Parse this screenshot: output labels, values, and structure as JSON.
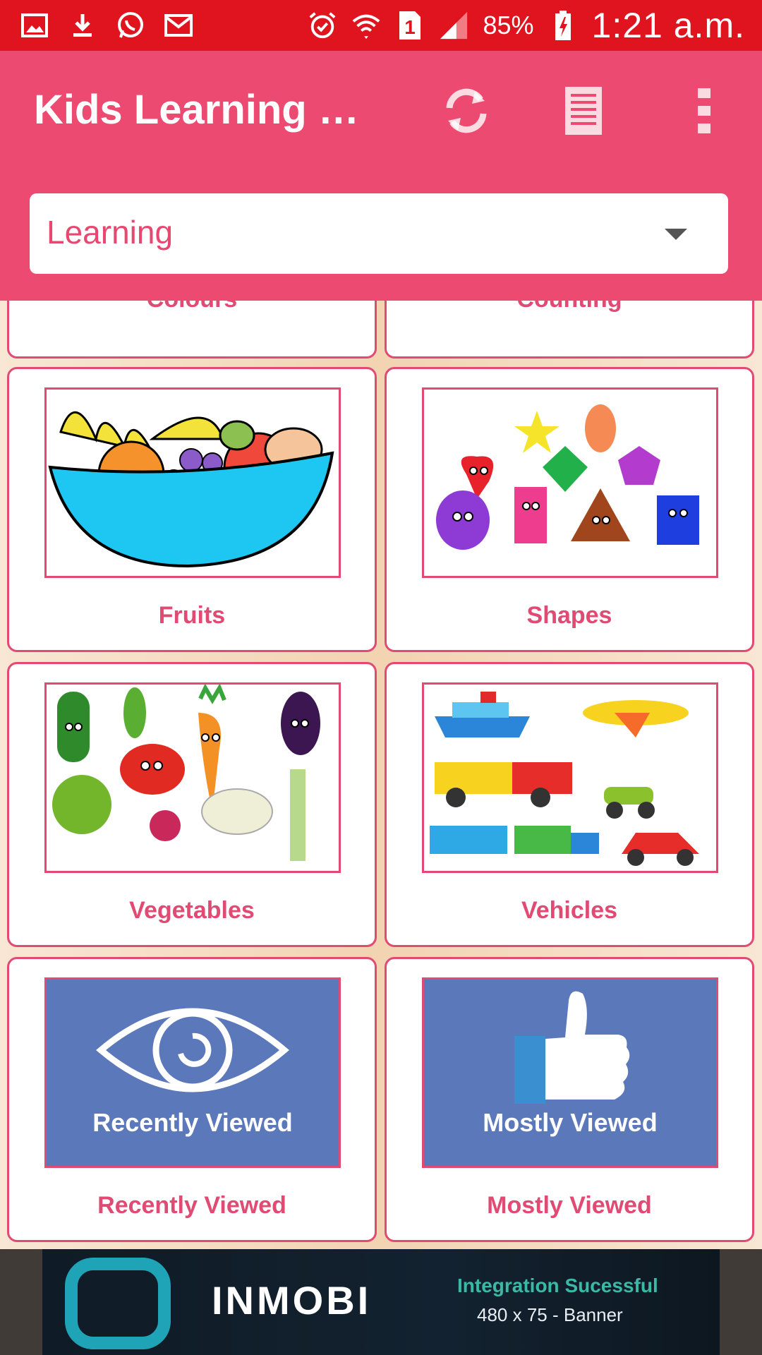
{
  "status_bar": {
    "icons_left": [
      "image-icon",
      "download-icon",
      "whatsapp-icon",
      "gmail-icon"
    ],
    "icons_right": [
      "alarm-icon",
      "wifi-icon",
      "sim1-icon",
      "signal-icon"
    ],
    "sim_badge": "1",
    "battery_percent": "85%",
    "time": "1:21 a.m."
  },
  "app_bar": {
    "title": "Kids Learning Vi...",
    "actions": [
      "refresh-icon",
      "list-icon",
      "more-vert-icon"
    ],
    "accent": "#ec4a71",
    "status_color": "#e0141f"
  },
  "category_select": {
    "value": "Learning"
  },
  "categories": [
    {
      "label": "Colours"
    },
    {
      "label": "Counting"
    },
    {
      "label": "Fruits"
    },
    {
      "label": "Shapes"
    },
    {
      "label": "Vegetables"
    },
    {
      "label": "Vehicles"
    },
    {
      "label": "Recently Viewed",
      "thumb_text": "Recently Viewed"
    },
    {
      "label": "Mostly Viewed",
      "thumb_text": "Mostly Viewed"
    }
  ],
  "ad_banner": {
    "brand": "INMOBI",
    "line1": "Integration Sucessful",
    "line2": "480 x 75 - Banner"
  }
}
